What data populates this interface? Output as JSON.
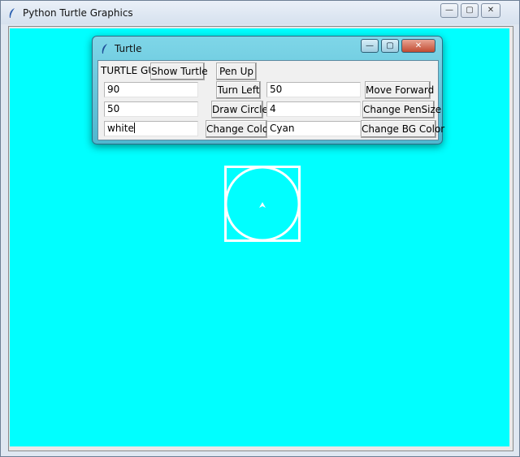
{
  "main_window": {
    "title": "Python Turtle Graphics",
    "controls": {
      "minimize": "—",
      "maximize": "▢",
      "close": "✕"
    }
  },
  "control_window": {
    "title": "Turtle",
    "controls": {
      "minimize": "—",
      "maximize": "▢",
      "close": "✕"
    },
    "label": "TURTLE GUI",
    "buttons": {
      "show_turtle": "Show Turtle",
      "pen_up": "Pen Up",
      "turn_left": "Turn Left",
      "move_forward": "Move Forward",
      "draw_circle": "Draw Circle",
      "change_pensize": "Change PenSize",
      "change_color": "Change Color",
      "change_bg_color": "Change BG Color"
    },
    "entries": {
      "turn_angle": "90",
      "forward_distance": "50",
      "circle_radius": "50",
      "pen_size": "4",
      "pen_color": "white",
      "bg_color": "Cyan"
    }
  },
  "canvas": {
    "background": "#00ffff",
    "pen_color": "#ffffff",
    "turtle_icon": "arrow-turtle-icon"
  }
}
